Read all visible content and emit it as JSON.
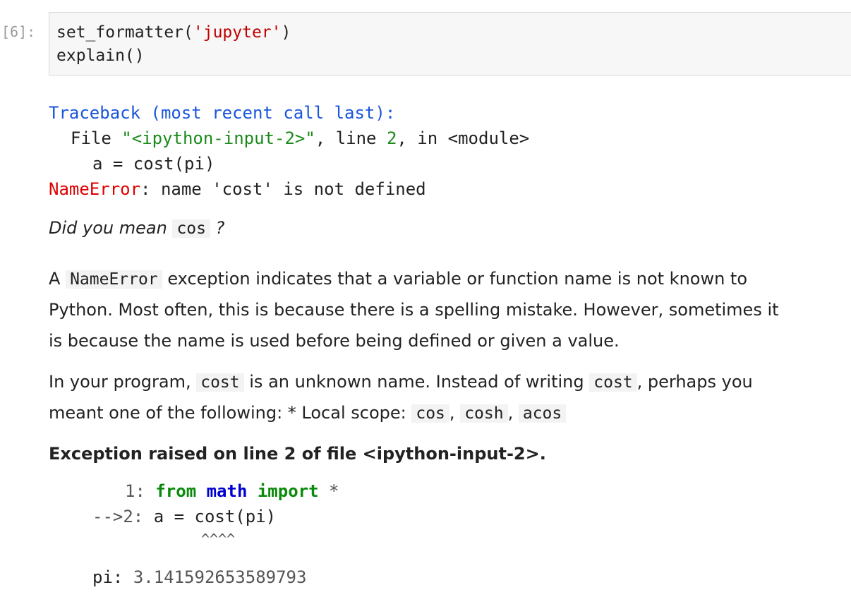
{
  "cell": {
    "prompt": "[6]:",
    "line1_func": "set_formatter(",
    "line1_arg": "'jupyter'",
    "line1_close": ")",
    "line2": "explain()"
  },
  "traceback": {
    "header": "Traceback (most recent call last):",
    "file_prefix": "File ",
    "file_name": "\"<ipython-input-2>\"",
    "file_mid": ", line ",
    "file_line": "2",
    "file_suffix": ", in <module>",
    "code": "a = cost(pi)",
    "error_name": "NameError",
    "error_msg": ": name 'cost' is not defined"
  },
  "suggestion": {
    "prefix": "Did you mean",
    "name": "cos",
    "suffix": "?"
  },
  "explanation": {
    "p1_a": "A",
    "p1_code": "NameError",
    "p1_b": "exception indicates that a variable or function name is not known to",
    "p1_line2": "Python. Most often, this is because there is a spelling mistake. However, sometimes it",
    "p1_line3": "is because the name is used before being defined or given a value.",
    "p2_a": "In your program,",
    "p2_code1": "cost",
    "p2_b": "is an unknown name. Instead of writing",
    "p2_code2": "cost",
    "p2_c": ", perhaps you",
    "p2_line2": "meant one of the following: * Local scope:",
    "p2_opt1": "cos",
    "p2_opt2": "cosh",
    "p2_opt3": "acos",
    "sep": ","
  },
  "location": {
    "text": "Exception raised on line 2 of file <ipython-input-2>."
  },
  "source": {
    "line1_num": "1:",
    "line1_from": "from",
    "line1_mod": "math",
    "line1_import": "import",
    "line1_star": "*",
    "line2_marker": "-->2:",
    "line2_code": "a = cost(pi)",
    "carets": "^^^^"
  },
  "variables": {
    "name": "pi:",
    "value": "3.141592653589793"
  }
}
